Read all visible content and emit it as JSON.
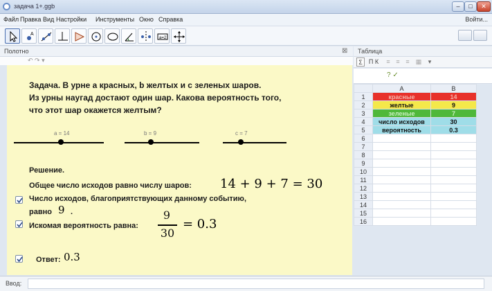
{
  "window": {
    "title": "задача 1+.ggb",
    "min": "–",
    "max": "□",
    "close": "✕"
  },
  "menu": {
    "items": [
      "Файл",
      "Правка",
      "Вид",
      "Настройки",
      "Инструменты",
      "Окно",
      "Справка"
    ],
    "login": "Войти..."
  },
  "toolbar": {
    "tools": [
      "move-tool",
      "point-tool",
      "line-tool",
      "perpendicular-tool",
      "polygon-tool",
      "circle-tool",
      "conic-tool",
      "angle-tool",
      "reflect-tool",
      "slider-tool",
      "move-view-tool"
    ]
  },
  "graphics": {
    "header": "Полотно",
    "undo_redo": "↶ ↷ ▾",
    "task_lines": [
      "Задача. В урне a красных, b желтых и c зеленых шаров.",
      "Из урны наугад достают один шар. Какова вероятность того,",
      "что этот шар окажется желтым?"
    ],
    "sliders": [
      {
        "label": "a = 14",
        "value": 14
      },
      {
        "label": "b = 9",
        "value": 9
      },
      {
        "label": "c = 7",
        "value": 7
      }
    ],
    "solution": {
      "title": "Решение.",
      "line1": "Общее число исходов равно числу шаров:",
      "line1_math": "14 + 9 + 7 = 30",
      "line2": "Число исходов, благоприятствующих данному событию,",
      "line3_prefix": "равно",
      "line3_value": "9",
      "line3_suffix": ".",
      "line4": "Искомая вероятность равна:",
      "frac_num": "9",
      "frac_den": "30",
      "frac_result": "= 0.3",
      "answer_label": "Ответ:",
      "answer_value": "0.3"
    }
  },
  "spreadsheet": {
    "header": "Таблица",
    "toolbar_text": "П  К",
    "columns": [
      "A",
      "B"
    ],
    "rows": [
      {
        "n": "1",
        "a": "красные",
        "b": "14",
        "color": "#e8312a"
      },
      {
        "n": "2",
        "a": "желтые",
        "b": "9",
        "color": "#f4e84a"
      },
      {
        "n": "3",
        "a": "зеленые",
        "b": "7",
        "color": "#4fb83a"
      },
      {
        "n": "4",
        "a": "число исходов",
        "b": "30",
        "color": "#9fdde8"
      },
      {
        "n": "5",
        "a": "вероятность",
        "b": "0.3",
        "color": "#9fdde8"
      },
      {
        "n": "6",
        "a": "",
        "b": "",
        "color": "#ffffff"
      },
      {
        "n": "7",
        "a": "",
        "b": "",
        "color": "#ffffff"
      },
      {
        "n": "8",
        "a": "",
        "b": "",
        "color": "#ffffff"
      },
      {
        "n": "9",
        "a": "",
        "b": "",
        "color": "#ffffff"
      },
      {
        "n": "10",
        "a": "",
        "b": "",
        "color": "#ffffff"
      },
      {
        "n": "11",
        "a": "",
        "b": "",
        "color": "#ffffff"
      },
      {
        "n": "12",
        "a": "",
        "b": "",
        "color": "#ffffff"
      },
      {
        "n": "13",
        "a": "",
        "b": "",
        "color": "#ffffff"
      },
      {
        "n": "14",
        "a": "",
        "b": "",
        "color": "#ffffff"
      },
      {
        "n": "15",
        "a": "",
        "b": "",
        "color": "#ffffff"
      },
      {
        "n": "16",
        "a": "",
        "b": "",
        "color": "#ffffff"
      }
    ]
  },
  "input": {
    "label": "Ввод:"
  },
  "colors": {
    "canvas": "#fbf9c7",
    "red": "#e8312a",
    "yellow": "#f4e84a",
    "green": "#4fb83a",
    "cyan": "#9fdde8"
  }
}
